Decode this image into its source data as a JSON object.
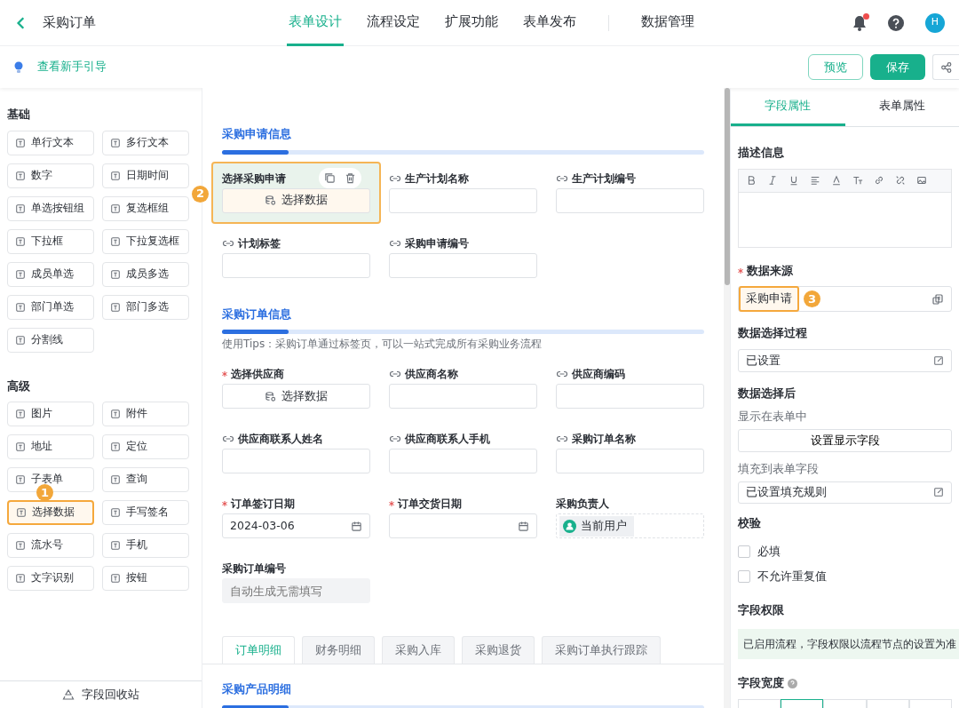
{
  "header": {
    "title": "采购订单",
    "tabs": [
      {
        "label": "表单设计",
        "selected": true
      },
      {
        "label": "流程设定",
        "selected": false
      },
      {
        "label": "扩展功能",
        "selected": false
      },
      {
        "label": "表单发布",
        "selected": false
      },
      {
        "label": "数据管理",
        "selected": false
      }
    ],
    "has_notification": true,
    "avatar": "H"
  },
  "toolbar": {
    "guide": "查看新手引导",
    "buttons": [
      {
        "label": "预览",
        "kind": "outline"
      },
      {
        "label": "保存",
        "kind": "primary"
      }
    ]
  },
  "palette": {
    "groups": [
      {
        "title": "基础",
        "items": [
          {
            "label": "单行文本",
            "selected": false
          },
          {
            "label": "多行文本",
            "selected": false
          },
          {
            "label": "数字",
            "selected": false
          },
          {
            "label": "日期时间",
            "selected": false
          },
          {
            "label": "单选按钮组",
            "selected": false
          },
          {
            "label": "复选框组",
            "selected": false
          },
          {
            "label": "下拉框",
            "selected": false
          },
          {
            "label": "下拉复选框",
            "selected": false
          },
          {
            "label": "成员单选",
            "selected": false
          },
          {
            "label": "成员多选",
            "selected": false
          },
          {
            "label": "部门单选",
            "selected": false
          },
          {
            "label": "部门多选",
            "selected": false
          },
          {
            "label": "分割线",
            "selected": false
          }
        ]
      },
      {
        "title": "高级",
        "items": [
          {
            "label": "图片",
            "selected": false
          },
          {
            "label": "附件",
            "selected": false
          },
          {
            "label": "地址",
            "selected": false
          },
          {
            "label": "定位",
            "selected": false
          },
          {
            "label": "子表单",
            "selected": false
          },
          {
            "label": "查询",
            "selected": false
          },
          {
            "label": "选择数据",
            "selected": true,
            "marker": "1"
          },
          {
            "label": "手写签名",
            "selected": false
          },
          {
            "label": "流水号",
            "selected": false
          },
          {
            "label": "手机",
            "selected": false
          },
          {
            "label": "文字识别",
            "selected": false
          },
          {
            "label": "按钮",
            "selected": false
          }
        ]
      }
    ],
    "recycle": "字段回收站"
  },
  "form": {
    "sections": [
      {
        "title": "采购申请信息",
        "fields": [
          {
            "label": "选择采购申请",
            "kind": "select",
            "button": "选择数据",
            "required": false,
            "selected": true,
            "marker": "2"
          },
          {
            "label": "生产计划名称",
            "kind": "linked",
            "required": false,
            "selected": false
          },
          {
            "label": "生产计划编号",
            "kind": "linked",
            "required": false,
            "selected": false
          },
          {
            "label": "计划标签",
            "kind": "linked",
            "required": false,
            "selected": false
          },
          {
            "label": "采购申请编号",
            "kind": "linked",
            "required": false,
            "selected": false
          }
        ]
      },
      {
        "title": "采购订单信息",
        "tips": "使用Tips：采购订单通过标签页，可以一站式完成所有采购业务流程",
        "fields": [
          {
            "label": "选择供应商",
            "kind": "select",
            "button": "选择数据",
            "required": true,
            "selected": false
          },
          {
            "label": "供应商名称",
            "kind": "linked",
            "required": false,
            "selected": false
          },
          {
            "label": "供应商编码",
            "kind": "linked",
            "required": false,
            "selected": false
          },
          {
            "label": "供应商联系人姓名",
            "kind": "linked",
            "required": false,
            "selected": false
          },
          {
            "label": "供应商联系人手机",
            "kind": "linked",
            "required": false,
            "selected": false
          },
          {
            "label": "采购订单名称",
            "kind": "linked",
            "required": false,
            "selected": false
          },
          {
            "label": "订单签订日期",
            "kind": "date",
            "value": "2024-03-06",
            "required": true,
            "selected": false
          },
          {
            "label": "订单交货日期",
            "kind": "date",
            "required": true,
            "selected": false
          },
          {
            "label": "采购负责人",
            "kind": "user",
            "value": "当前用户",
            "required": false,
            "selected": false
          },
          {
            "label": "采购订单编号",
            "kind": "auto",
            "placeholder": "自动生成无需填写",
            "required": false,
            "selected": false
          }
        ]
      }
    ],
    "tabs": [
      {
        "label": "订单明细",
        "selected": true
      },
      {
        "label": "财务明细",
        "selected": false
      },
      {
        "label": "采购入库",
        "selected": false
      },
      {
        "label": "采购退货",
        "selected": false
      },
      {
        "label": "采购订单执行跟踪",
        "selected": false
      }
    ],
    "subsection": "采购产品明细"
  },
  "properties": {
    "tabs": [
      {
        "label": "字段属性",
        "selected": true
      },
      {
        "label": "表单属性",
        "selected": false
      }
    ],
    "description": "描述信息",
    "source_label": "数据来源",
    "source_required": true,
    "source_value": "采购申请",
    "source_marker": "3",
    "process_label": "数据选择过程",
    "process_value": "已设置",
    "after_label": "数据选择后",
    "show_label": "显示在表单中",
    "show_button": "设置显示字段",
    "fill_label": "填充到表单字段",
    "fill_value": "已设置填充规则",
    "validate_label": "校验",
    "checks": [
      {
        "label": "必填",
        "checked": false
      },
      {
        "label": "不允许重复值",
        "checked": false
      }
    ],
    "permission_label": "字段权限",
    "permission_notice": "已启用流程，字段权限以流程节点的设置为准",
    "width_label": "字段宽度"
  }
}
